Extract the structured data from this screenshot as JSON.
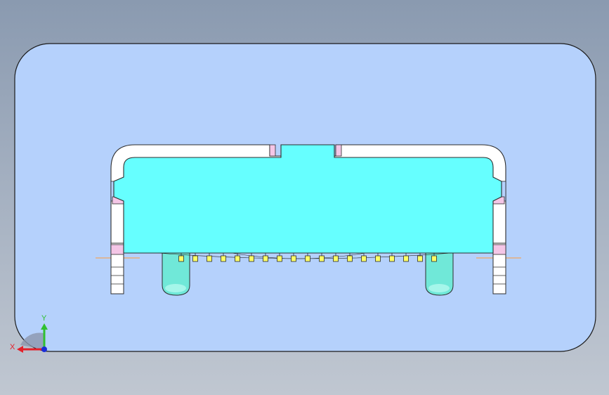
{
  "viewport": {
    "background_top": "#8a9ab0",
    "background_bottom": "#c0c7d1",
    "panel_fill": "#b5d1fc",
    "panel_stroke": "#1b1b1b"
  },
  "model": {
    "body_color": "#66ffff",
    "shell_color": "#ffffff",
    "shell_edge": "#2c2c2c",
    "shell_accent": "#f4c6e6",
    "post_color": "#70e8d8",
    "pin_color": "#ffff66",
    "centerline_color": "#ff9a3c",
    "pin_count": 19
  },
  "triad": {
    "x_label": "X",
    "y_label": "Y",
    "x_color": "#e4202a",
    "y_color": "#30c030",
    "z_color": "#1a2cd8"
  }
}
